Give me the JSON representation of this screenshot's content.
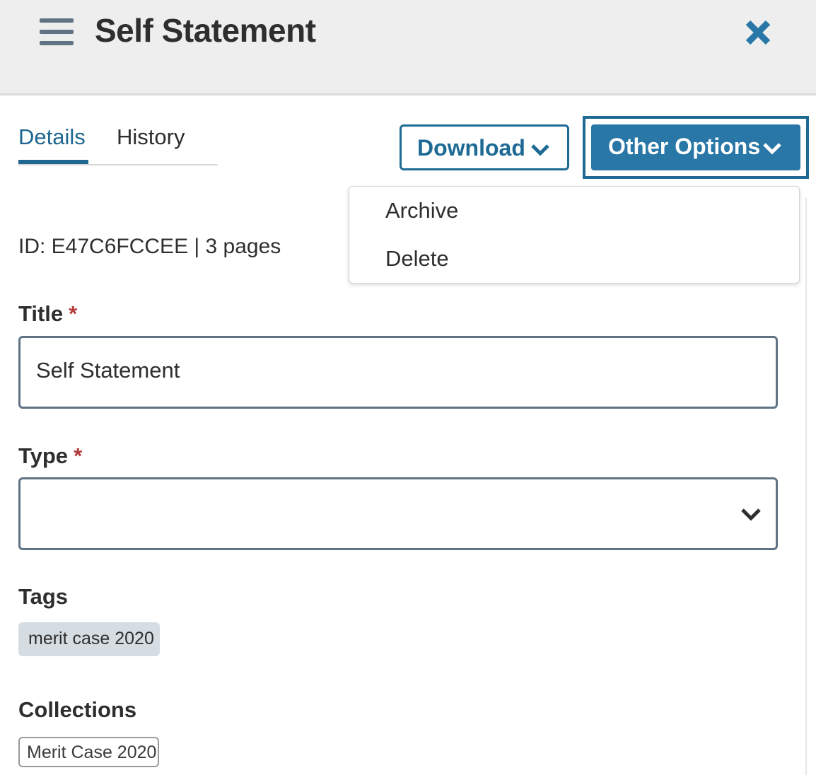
{
  "header": {
    "title": "Self Statement",
    "menu_icon": "hamburger-menu-icon",
    "close_icon": "close-x-icon"
  },
  "tabs": [
    {
      "label": "Details",
      "active": true
    },
    {
      "label": "History",
      "active": false
    }
  ],
  "actions": {
    "download_label": "Download",
    "other_options_label": "Other Options"
  },
  "other_options_menu": {
    "items": [
      "Archive",
      "Delete"
    ]
  },
  "document": {
    "meta": "ID: E47C6FCCEE | 3 pages"
  },
  "form": {
    "title_label": "Title",
    "title_value": "Self Statement",
    "type_label": "Type",
    "type_value": "",
    "required_marker": "*",
    "tags_label": "Tags",
    "tags": [
      "merit case 2020"
    ],
    "collections_label": "Collections",
    "collections": [
      "Merit Case 2020"
    ]
  },
  "colors": {
    "accent": "#2877a6",
    "accent_dark": "#1e6a94",
    "required": "#b33a3a",
    "header_bg": "#eeeeee",
    "tag_bg": "#d5dde3"
  }
}
